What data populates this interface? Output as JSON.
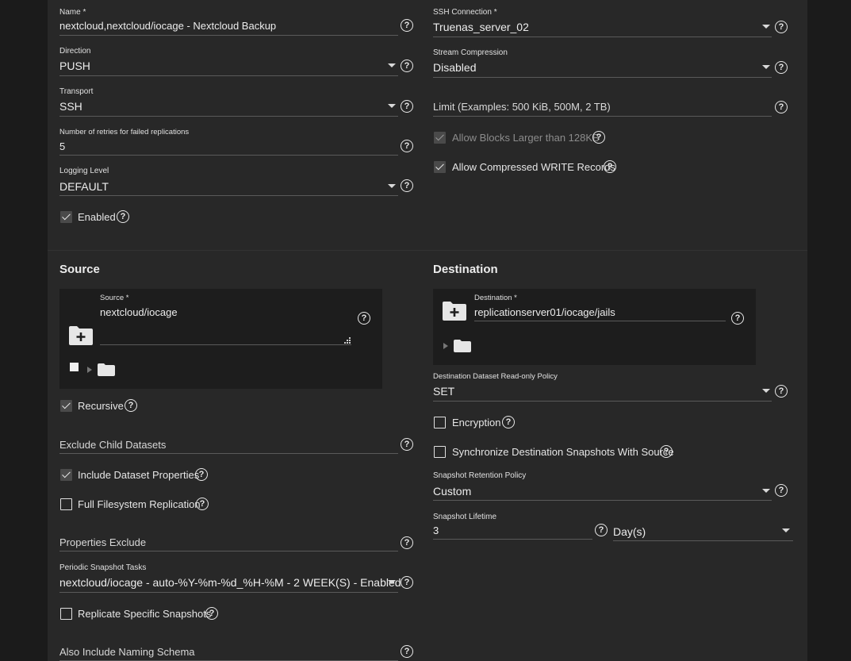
{
  "left": {
    "name": {
      "label": "Name *",
      "value": "nextcloud,nextcloud/iocage - Nextcloud Backup"
    },
    "direction": {
      "label": "Direction",
      "value": "PUSH"
    },
    "transport": {
      "label": "Transport",
      "value": "SSH"
    },
    "retries": {
      "label": "Number of retries for failed replications",
      "value": "5"
    },
    "logging": {
      "label": "Logging Level",
      "value": "DEFAULT"
    },
    "enabled": {
      "label": "Enabled",
      "checked": true
    }
  },
  "right": {
    "ssh": {
      "label": "SSH Connection *",
      "value": "Truenas_server_02"
    },
    "compression": {
      "label": "Stream Compression",
      "value": "Disabled"
    },
    "limit": {
      "placeholder": "Limit (Examples: 500 KiB, 500M, 2 TB)"
    },
    "large_blocks": {
      "label": "Allow Blocks Larger than 128KB",
      "checked": true,
      "disabled": true
    },
    "compressed_write": {
      "label": "Allow Compressed WRITE Records",
      "checked": true
    }
  },
  "source": {
    "title": "Source",
    "field_label": "Source *",
    "value": "nextcloud/iocage",
    "recursive": {
      "label": "Recursive",
      "checked": true
    },
    "exclude_child": {
      "placeholder": "Exclude Child Datasets"
    },
    "include_props": {
      "label": "Include Dataset Properties",
      "checked": true
    },
    "full_fs": {
      "label": "Full Filesystem Replication",
      "checked": false
    },
    "props_exclude": {
      "placeholder": "Properties Exclude"
    },
    "periodic": {
      "label": "Periodic Snapshot Tasks",
      "value": "nextcloud/iocage - auto-%Y-%m-%d_%H-%M - 2 WEEK(S) - Enabled"
    },
    "replicate_specific": {
      "label": "Replicate Specific Snapshots",
      "checked": false
    },
    "naming_schema": {
      "placeholder": "Also Include Naming Schema"
    }
  },
  "destination": {
    "title": "Destination",
    "field_label": "Destination *",
    "value": "replicationserver01/iocage/jails",
    "readonly_policy": {
      "label": "Destination Dataset Read-only Policy",
      "value": "SET"
    },
    "encryption": {
      "label": "Encryption",
      "checked": false
    },
    "sync_snapshots": {
      "label": "Synchronize Destination Snapshots With Source",
      "checked": false
    },
    "retention": {
      "label": "Snapshot Retention Policy",
      "value": "Custom"
    },
    "lifetime": {
      "label": "Snapshot Lifetime",
      "value": "3",
      "unit": "Day(s)"
    }
  },
  "icons": {
    "help": "?",
    "select": "chevron-down-icon",
    "folder": "folder-icon",
    "add_folder": "create-folder-icon"
  },
  "colors": {
    "background": "#282828",
    "outer": "#1b1b1b",
    "tree_box": "#1d1d1d"
  }
}
